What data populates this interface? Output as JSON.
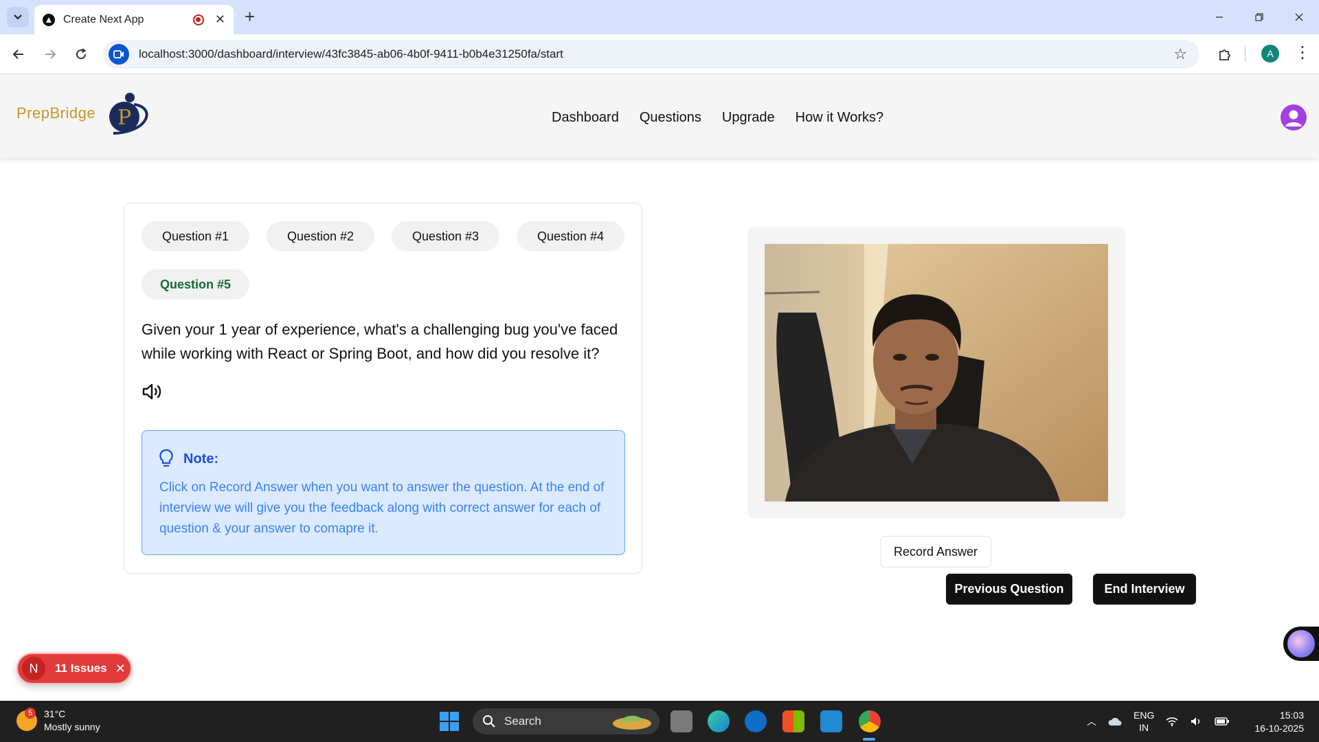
{
  "browser": {
    "tab_title": "Create Next App",
    "url": "localhost:3000/dashboard/interview/43fc3845-ab06-4b0f-9411-b0b4e31250fa/start",
    "profile_initial": "A"
  },
  "app": {
    "brand": "PrepBridge",
    "nav": [
      "Dashboard",
      "Questions",
      "Upgrade",
      "How it Works?"
    ]
  },
  "interview": {
    "questions": [
      "Question #1",
      "Question #2",
      "Question #3",
      "Question #4",
      "Question #5"
    ],
    "active_index": 4,
    "question_text": "Given your 1 year of experience, what's a challenging bug you've faced while working with React or Spring Boot, and how did you resolve it?",
    "note_title": "Note:",
    "note_body": "Click on Record Answer when you want to answer the question. At the end of interview we will give you the feedback along with correct answer for each of question & your answer to comapre it.",
    "record_label": "Record Answer",
    "previous_label": "Previous Question",
    "end_label": "End Interview"
  },
  "dev_overlay": {
    "badge": "N",
    "issues_label": "11 Issues"
  },
  "taskbar": {
    "weather_badge": "5",
    "temp": "31°C",
    "condition": "Mostly sunny",
    "search_label": "Search",
    "lang_top": "ENG",
    "lang_bottom": "IN",
    "time": "15:03",
    "date": "16-10-2025"
  },
  "colors": {
    "brand": "#c9952a",
    "active_question": "#156b35",
    "note_title": "#1d4ed8",
    "note_text": "#3b82f6",
    "issues": "#e23b3b"
  }
}
